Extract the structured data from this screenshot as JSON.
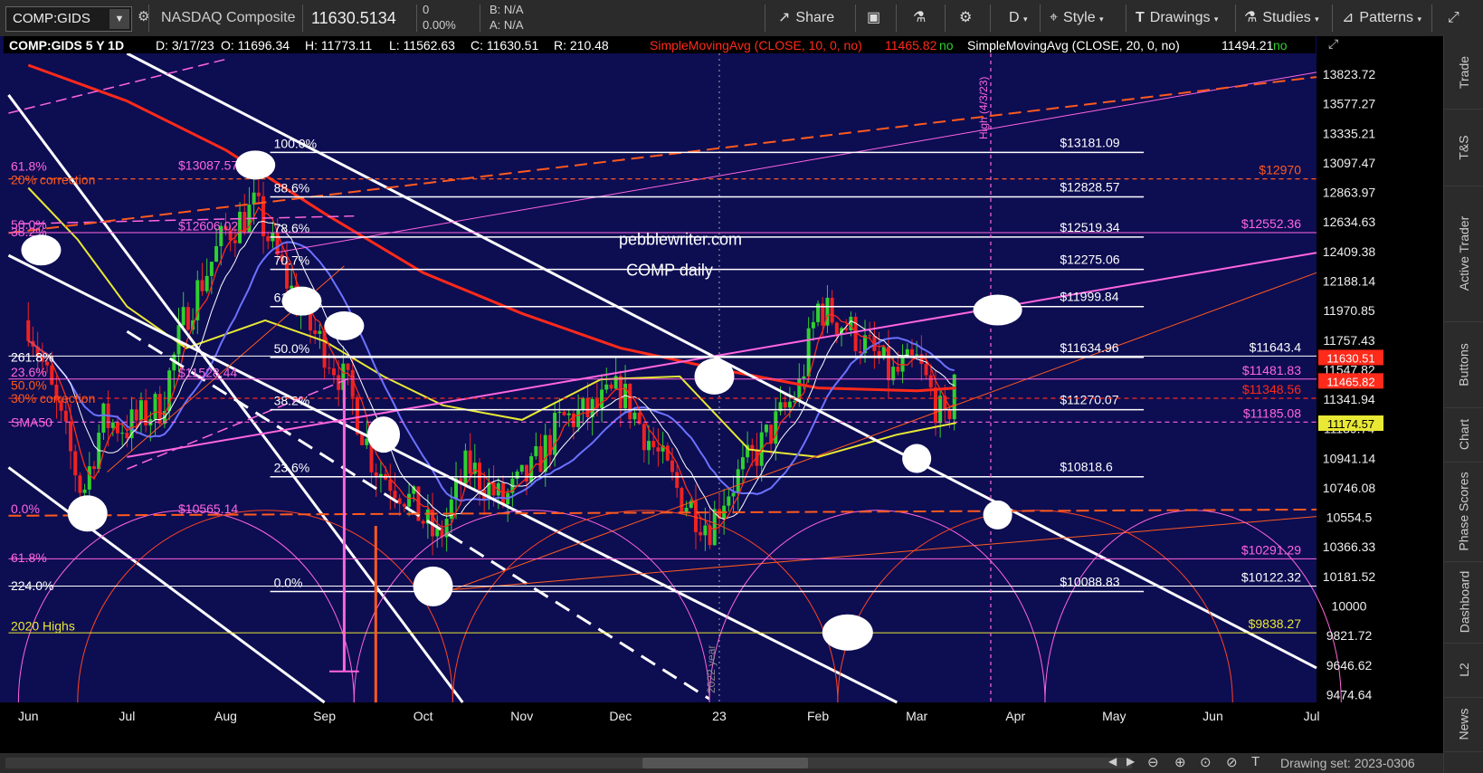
{
  "toolbar": {
    "symbol": "COMP:GIDS",
    "name": "NASDAQ Composite",
    "last": "11630.5134",
    "change": "0",
    "change_pct": "0.00%",
    "bid": "B: N/A",
    "ask": "A: N/A",
    "share": "Share",
    "period": "D",
    "style": "Style",
    "drawings": "Drawings",
    "studies": "Studies",
    "patterns": "Patterns"
  },
  "header": {
    "title": "COMP:GIDS 5 Y 1D",
    "date": "D: 3/17/23",
    "open": "O: 11696.34",
    "high": "H: 11773.11",
    "low": "L: 11562.63",
    "close": "C: 11630.51",
    "range": "R: 210.48",
    "sma10": "SimpleMovingAvg (CLOSE, 10, 0, no)",
    "sma10_val": "11465.82",
    "sma20": "SimpleMovingAvg (CLOSE, 20, 0, no)",
    "sma20_val": "11494.21",
    "no": "no"
  },
  "side_tabs": [
    "Trade",
    "T&S",
    "Active Trader",
    "Buttons",
    "Chart",
    "Phase Scores",
    "Dashboard",
    "L2",
    "News"
  ],
  "bottom": {
    "drawing_set": "Drawing set: 2023-0306"
  },
  "colors": {
    "bg": "#0d0d52",
    "candle_up": "#2fcf2f",
    "candle_down": "#ee2222",
    "sma200": "#ff2a1a",
    "sma100": "#e8e835",
    "sma50": "#6b72ff",
    "sma10": "#ff2a1a",
    "fib": "#ffffff",
    "magenta": "#ff66dd",
    "orange": "#ff5a1e"
  },
  "chart_data": {
    "type": "candlestick",
    "title": "",
    "annotation": "pebblewriter.com\nCOMP daily",
    "x_ticks": [
      "Jun",
      "Jul",
      "Aug",
      "Sep",
      "Oct",
      "Nov",
      "Dec",
      "23",
      "Feb",
      "Mar",
      "Apr",
      "May",
      "Jun",
      "Jul"
    ],
    "x_tick_times": [
      0,
      1,
      2,
      3,
      4,
      5,
      6,
      7,
      8,
      9,
      10,
      11,
      12,
      13
    ],
    "y_ticks": [
      13823.72,
      13577.27,
      13335.21,
      13097.47,
      12863.97,
      12634.63,
      12409.38,
      12188.14,
      11970.85,
      11757.43,
      11547.82,
      11341.94,
      11139.74,
      10941.14,
      10746.08,
      10554.5,
      10366.33,
      10181.52,
      10000,
      9821.72,
      9646.62,
      9474.64
    ],
    "y_tick_labels": [
      "13823.72",
      "13577.27",
      "13335.21",
      "13097.47",
      "12863.97",
      "12634.63",
      "12409.38",
      "12188.14",
      "11970.85",
      "11757.43",
      "11547.82",
      "11341.94",
      "11139.74",
      "10941.14",
      "10746.08",
      "10554.5",
      "10366.33",
      "10181.52",
      "10000",
      "9821.72",
      "9646.62",
      "9474.64"
    ],
    "y_scale": "log",
    "ylim": [
      9430,
      14000
    ],
    "xlim": [
      -0.25,
      13.05
    ],
    "grid": false,
    "price_labels": [
      {
        "text": "11630.51",
        "value": 11630.51,
        "color": "#ff2a1a"
      },
      {
        "text": "11465.82",
        "value": 11465.82,
        "color": "#ff2a1a"
      },
      {
        "text": "11174.57",
        "value": 11174.57,
        "color": "#e8e835"
      }
    ],
    "fib_levels": [
      {
        "pct": "100.0%",
        "value": 13181.09,
        "label": "$13181.09"
      },
      {
        "pct": "88.6%",
        "value": 12828.57,
        "label": "$12828.57"
      },
      {
        "pct": "78.6%",
        "value": 12519.34,
        "label": "$12519.34"
      },
      {
        "pct": "70.7%",
        "value": 12275.06,
        "label": "$12275.06"
      },
      {
        "pct": "61.8%",
        "value": 11999.84,
        "label": "$11999.84"
      },
      {
        "pct": "50.0%",
        "value": 11634.96,
        "label": "$11634.96"
      },
      {
        "pct": "38.2%",
        "value": 11270.07,
        "label": "$11270.07"
      },
      {
        "pct": "23.6%",
        "value": 10818.6,
        "label": "$10818.6"
      },
      {
        "pct": "0.0%",
        "value": 10088.83,
        "label": "$10088.83"
      }
    ],
    "levels": [
      {
        "text": "$12970",
        "value": 12970,
        "color": "#ff5a1e",
        "dash": true
      },
      {
        "text": "$12552.36",
        "value": 12552.36,
        "color": "#ff66dd"
      },
      {
        "text": "$11643.4",
        "value": 11643.4,
        "color": "#ffffff"
      },
      {
        "text": "$11481.83",
        "value": 11481.83,
        "color": "#ff66dd"
      },
      {
        "text": "$11348.56",
        "value": 11348.56,
        "color": "#ff2a1a",
        "dash": true
      },
      {
        "text": "$11185.08",
        "value": 11185.08,
        "color": "#ff66dd",
        "dash": true
      },
      {
        "text": "$10291.29",
        "value": 10291.29,
        "color": "#ff66dd"
      },
      {
        "text": "$10122.32",
        "value": 10122.32,
        "color": "#ffffff"
      },
      {
        "text": "$9838.27",
        "value": 9838.27,
        "color": "#e8e835"
      }
    ],
    "left_labels": [
      {
        "text": "61.8%",
        "value": 13070,
        "color": "#ff66dd"
      },
      {
        "text": "$13087.57",
        "value": 13080,
        "color": "#ff66dd"
      },
      {
        "text": "20% correction",
        "value": 12965,
        "color": "#ff5a1e"
      },
      {
        "text": "50.0%",
        "value": 12615,
        "color": "#ff66dd"
      },
      {
        "text": "$12606.02",
        "value": 12606,
        "color": "#ff66dd"
      },
      {
        "text": "38.2%",
        "value": 12560,
        "color": "#ff66dd"
      },
      {
        "text": "261.8%",
        "value": 11635,
        "color": "#ffffff"
      },
      {
        "text": "23.6%",
        "value": 11530,
        "color": "#ff66dd"
      },
      {
        "text": "$11528.44",
        "value": 11528,
        "color": "#ff66dd"
      },
      {
        "text": "50.0%",
        "value": 11440,
        "color": "#ff5a1e"
      },
      {
        "text": "30% correction",
        "value": 11348,
        "color": "#ff5a1e"
      },
      {
        "text": "SMA50",
        "value": 11185,
        "color": "#ff66dd"
      },
      {
        "text": "0.0%",
        "value": 10610,
        "color": "#ff66dd"
      },
      {
        "text": "$10565.14",
        "value": 10610,
        "color": "#ff66dd"
      },
      {
        "text": "61.8%",
        "value": 10300,
        "color": "#ff66dd"
      },
      {
        "text": "224.0%",
        "value": 10125,
        "color": "#ffffff"
      },
      {
        "text": "2020 Highs",
        "value": 9880,
        "color": "#e8e835"
      }
    ],
    "high_label": "High (4/3/23)",
    "year_label": "2022 year"
  }
}
